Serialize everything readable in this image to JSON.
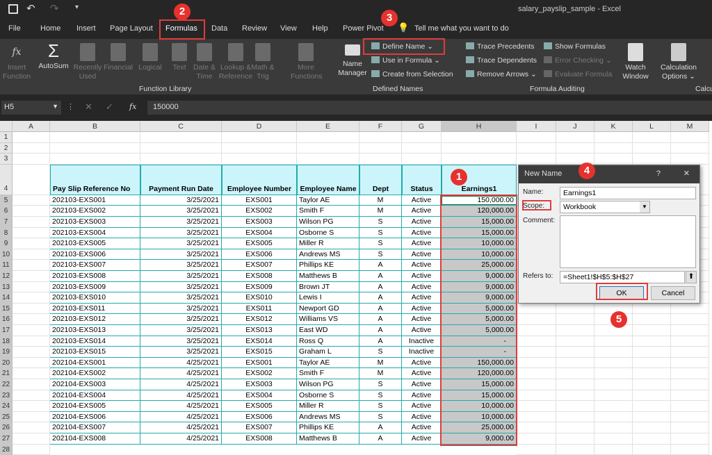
{
  "window": {
    "title": "salary_payslip_sample  -  Excel"
  },
  "qat": {
    "save_icon": "save-icon",
    "undo_icon": "undo-icon",
    "redo_icon": "redo-icon"
  },
  "tabs": [
    "File",
    "Home",
    "Insert",
    "Page Layout",
    "Formulas",
    "Data",
    "Review",
    "View",
    "Help",
    "Power Pivot"
  ],
  "active_tab": "Formulas",
  "tell_me": "Tell me what you want to do",
  "ribbon": {
    "function_library": {
      "label": "Function Library",
      "items": [
        "Insert Function",
        "AutoSum",
        "Recently Used",
        "Financial",
        "Logical",
        "Text",
        "Date & Time",
        "Lookup & Reference",
        "Math & Trig",
        "More Functions"
      ]
    },
    "defined_names": {
      "label": "Defined Names",
      "name_manager": "Name Manager",
      "define_name": "Define Name",
      "use_in_formula": "Use in Formula",
      "create_from_selection": "Create from Selection"
    },
    "formula_auditing": {
      "label": "Formula Auditing",
      "trace_precedents": "Trace Precedents",
      "trace_dependents": "Trace Dependents",
      "remove_arrows": "Remove Arrows",
      "show_formulas": "Show Formulas",
      "error_checking": "Error Checking",
      "evaluate_formula": "Evaluate Formula",
      "watch_window": "Watch Window"
    },
    "calculation": {
      "label": "Calcu",
      "options": "Calculation Options"
    }
  },
  "formula_bar": {
    "name_box": "H5",
    "value": "150000"
  },
  "columns": [
    "A",
    "B",
    "C",
    "D",
    "E",
    "F",
    "G",
    "H",
    "I",
    "J",
    "K",
    "L",
    "M"
  ],
  "headers": [
    "Pay Slip Reference No",
    "Payment Run Date",
    "Employee Number",
    "Employee Name",
    "Dept",
    "Status",
    "Earnings1"
  ],
  "rows": [
    [
      "202103-EXS001",
      "3/25/2021",
      "EXS001",
      "Taylor AE",
      "M",
      "Active",
      "150,000.00"
    ],
    [
      "202103-EXS002",
      "3/25/2021",
      "EXS002",
      "Smith F",
      "M",
      "Active",
      "120,000.00"
    ],
    [
      "202103-EXS003",
      "3/25/2021",
      "EXS003",
      "Wilson PG",
      "S",
      "Active",
      "15,000.00"
    ],
    [
      "202103-EXS004",
      "3/25/2021",
      "EXS004",
      "Osborne S",
      "S",
      "Active",
      "15,000.00"
    ],
    [
      "202103-EXS005",
      "3/25/2021",
      "EXS005",
      "Miller R",
      "S",
      "Active",
      "10,000.00"
    ],
    [
      "202103-EXS006",
      "3/25/2021",
      "EXS006",
      "Andrews MS",
      "S",
      "Active",
      "10,000.00"
    ],
    [
      "202103-EXS007",
      "3/25/2021",
      "EXS007",
      "Phillips KE",
      "A",
      "Active",
      "25,000.00"
    ],
    [
      "202103-EXS008",
      "3/25/2021",
      "EXS008",
      "Matthews B",
      "A",
      "Active",
      "9,000.00"
    ],
    [
      "202103-EXS009",
      "3/25/2021",
      "EXS009",
      "Brown JT",
      "A",
      "Active",
      "9,000.00"
    ],
    [
      "202103-EXS010",
      "3/25/2021",
      "EXS010",
      "Lewis I",
      "A",
      "Active",
      "9,000.00"
    ],
    [
      "202103-EXS011",
      "3/25/2021",
      "EXS011",
      "Newport GD",
      "A",
      "Active",
      "5,000.00"
    ],
    [
      "202103-EXS012",
      "3/25/2021",
      "EXS012",
      "Williams VS",
      "A",
      "Active",
      "5,000.00"
    ],
    [
      "202103-EXS013",
      "3/25/2021",
      "EXS013",
      "East WD",
      "A",
      "Active",
      "5,000.00"
    ],
    [
      "202103-EXS014",
      "3/25/2021",
      "EXS014",
      "Ross Q",
      "A",
      "Inactive",
      "-"
    ],
    [
      "202103-EXS015",
      "3/25/2021",
      "EXS015",
      "Graham L",
      "S",
      "Inactive",
      "-"
    ],
    [
      "202104-EXS001",
      "4/25/2021",
      "EXS001",
      "Taylor AE",
      "M",
      "Active",
      "150,000.00"
    ],
    [
      "202104-EXS002",
      "4/25/2021",
      "EXS002",
      "Smith F",
      "M",
      "Active",
      "120,000.00"
    ],
    [
      "202104-EXS003",
      "4/25/2021",
      "EXS003",
      "Wilson PG",
      "S",
      "Active",
      "15,000.00"
    ],
    [
      "202104-EXS004",
      "4/25/2021",
      "EXS004",
      "Osborne S",
      "S",
      "Active",
      "15,000.00"
    ],
    [
      "202104-EXS005",
      "4/25/2021",
      "EXS005",
      "Miller R",
      "S",
      "Active",
      "10,000.00"
    ],
    [
      "202104-EXS006",
      "4/25/2021",
      "EXS006",
      "Andrews MS",
      "S",
      "Active",
      "10,000.00"
    ],
    [
      "202104-EXS007",
      "4/25/2021",
      "EXS007",
      "Phillips KE",
      "A",
      "Active",
      "25,000.00"
    ],
    [
      "202104-EXS008",
      "4/25/2021",
      "EXS008",
      "Matthews B",
      "A",
      "Active",
      "9,000.00"
    ]
  ],
  "dialog": {
    "title": "New Name",
    "help": "?",
    "close": "✕",
    "name_label": "Name:",
    "name_value": "Earnings1",
    "scope_label": "Scope:",
    "scope_value": "Workbook",
    "comment_label": "Comment:",
    "refers_label": "Refers to:",
    "refers_value": "=Sheet1!$H$5:$H$27",
    "ok": "OK",
    "cancel": "Cancel"
  },
  "annotations": [
    "1",
    "2",
    "3",
    "4",
    "5"
  ],
  "colors": {
    "accent": "#e6322e",
    "header_fill": "#ccf5fb",
    "table_border": "#22aaaa",
    "selection": "#c8c8c8"
  }
}
